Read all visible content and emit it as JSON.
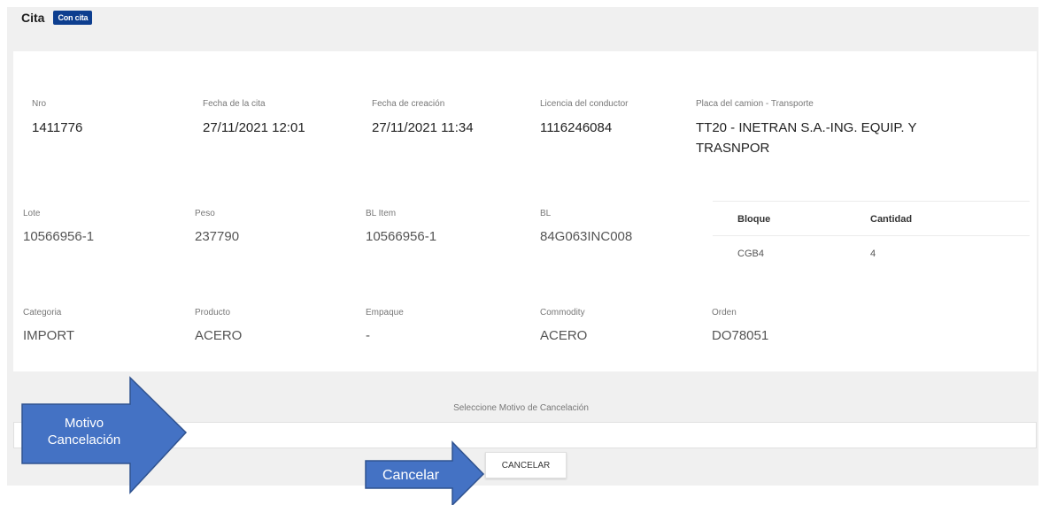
{
  "header": {
    "title": "Cita",
    "badge": "Con cita"
  },
  "row1": [
    {
      "label": "Nro",
      "value": "1411776"
    },
    {
      "label": "Fecha de la cita",
      "value": "27/11/2021 12:01"
    },
    {
      "label": "Fecha de creación",
      "value": "27/11/2021 11:34"
    },
    {
      "label": "Licencia del conductor",
      "value": "1116246084"
    },
    {
      "label": "Placa del camion - Transporte",
      "value_line1": "TT20 - INETRAN S.A.-ING. EQUIP. Y",
      "value_line2": "TRASNPOR"
    }
  ],
  "row2": [
    {
      "label": "Lote",
      "value": "10566956-1"
    },
    {
      "label": "Peso",
      "value": "237790"
    },
    {
      "label": "BL Item",
      "value": "10566956-1"
    },
    {
      "label": "BL",
      "value": "84G063INC008"
    }
  ],
  "block_table": {
    "headers": [
      "Bloque",
      "Cantidad"
    ],
    "rows": [
      [
        "CGB4",
        "4"
      ]
    ]
  },
  "row3": [
    {
      "label": "Categoria",
      "value": "IMPORT"
    },
    {
      "label": "Producto",
      "value": "ACERO"
    },
    {
      "label": "Empaque",
      "value": "-"
    },
    {
      "label": "Commodity",
      "value": "ACERO"
    },
    {
      "label": "Orden",
      "value": "DO78051"
    }
  ],
  "cancel_reason": {
    "label": "Seleccione Motivo de Cancelación",
    "value": ""
  },
  "cancel_button": "CANCELAR",
  "annotations": {
    "motivo_line1": "Motivo",
    "motivo_line2": "Cancelación",
    "cancelar": "Cancelar",
    "arrow_color": "#4472c4"
  }
}
